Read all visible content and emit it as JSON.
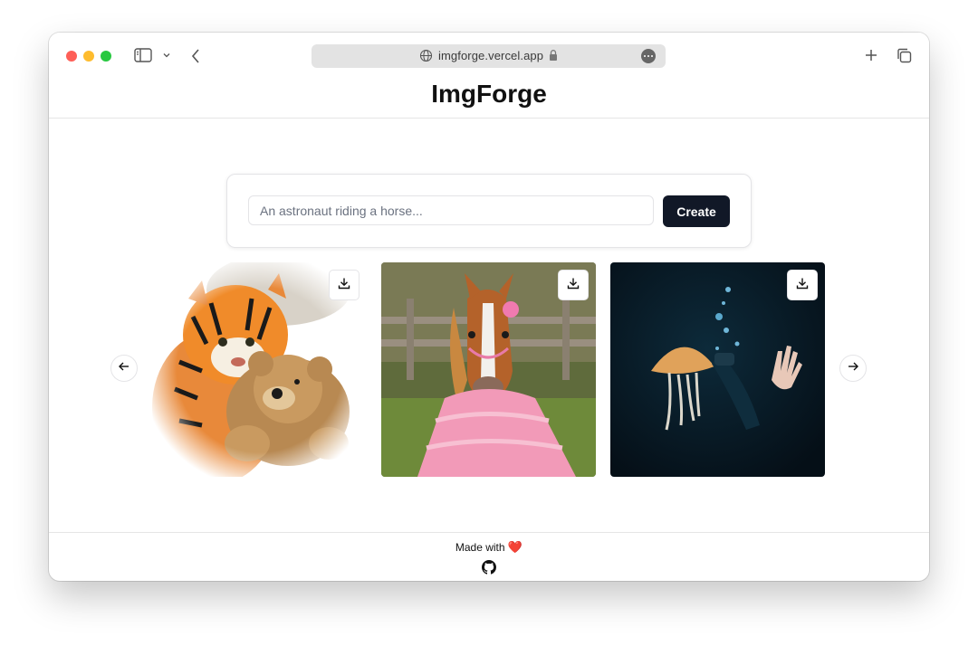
{
  "browser": {
    "url": "imgforge.vercel.app",
    "icons": [
      "sidebar-icon",
      "chevron-down-icon",
      "back-icon",
      "globe-icon",
      "lock-icon",
      "more-icon",
      "new-tab-icon",
      "tabs-overview-icon"
    ]
  },
  "app": {
    "title": "ImgForge"
  },
  "prompt": {
    "placeholder": "An astronaut riding a horse...",
    "value": "",
    "button_label": "Create"
  },
  "gallery": {
    "items": [
      {
        "subject": "tiger hugging teddy bear",
        "action_icon": "download-icon"
      },
      {
        "subject": "horse in pink dress",
        "action_icon": "download-icon"
      },
      {
        "subject": "jellyfish underwater with hand",
        "action_icon": "download-icon"
      }
    ],
    "prev_icon": "arrow-left-icon",
    "next_icon": "arrow-right-icon"
  },
  "footer": {
    "made_with": "Made with",
    "heart": "❤️",
    "link_icon": "github-icon"
  }
}
